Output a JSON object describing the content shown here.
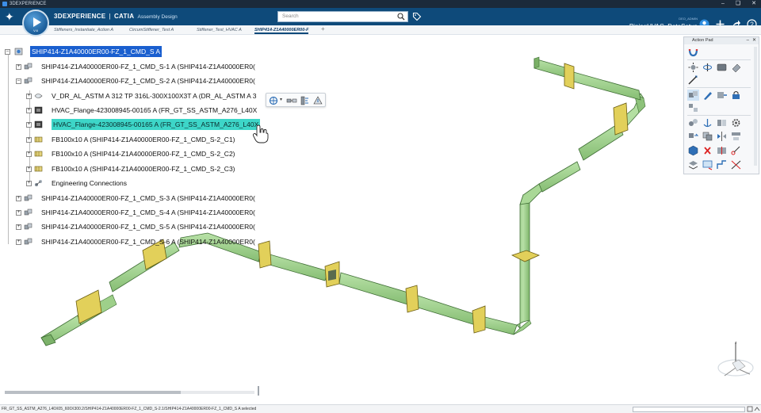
{
  "os": {
    "title": "3DEXPERIENCE"
  },
  "header": {
    "brand": "3DEXPERIENCE",
    "separator": "|",
    "product": "CATIA",
    "app_name": "Assembly Design",
    "search_placeholder": "Search",
    "user_small": "DEO_ADMIN",
    "user_name": "PipingHVAC_DataSetup",
    "compass_label": "V.6"
  },
  "tabs": [
    {
      "label": "Stiffeners_Instantiate_Action A"
    },
    {
      "label": "CircumStiffener_Test A"
    },
    {
      "label": "Stiffener_Test_HVAC A"
    },
    {
      "label": "SHIP414-Z1A40000ER00-F"
    }
  ],
  "tree": {
    "root": "SHIP414-Z1A40000ER00-FZ_1_CMD_S A",
    "nodes": [
      "SHIP414-Z1A40000ER00-FZ_1_CMD_S-1 A (SHIP414-Z1A40000ER0(",
      "SHIP414-Z1A40000ER00-FZ_1_CMD_S-2 A (SHIP414-Z1A40000ER0(",
      "V_DR_AL_ASTM A 312 TP 316L-300X100X3T A (DR_AL_ASTM A 3",
      "HVAC_Flange-423008945-00165 A (FR_GT_SS_ASTM_A276_L40X",
      "HVAC_Flange-423008945-00165 A (FR_GT_SS_ASTM_A276_L40X",
      "FB100x10 A (SHIP414-Z1A40000ER00-FZ_1_CMD_S-2_C1)",
      "FB100x10 A (SHIP414-Z1A40000ER00-FZ_1_CMD_S-2_C2)",
      "FB100x10 A (SHIP414-Z1A40000ER00-FZ_1_CMD_S-2_C3)",
      "Engineering Connections",
      "SHIP414-Z1A40000ER00-FZ_1_CMD_S-3 A (SHIP414-Z1A40000ER0(",
      "SHIP414-Z1A40000ER00-FZ_1_CMD_S-4 A (SHIP414-Z1A40000ER0(",
      "SHIP414-Z1A40000ER00-FZ_1_CMD_S-5 A (SHIP414-Z1A40000ER0(",
      "SHIP414-Z1A40000ER00-FZ_1_CMD_S-6 A (SHIP414-Z1A40000ER0("
    ]
  },
  "action_pad": {
    "title": "Action Pad"
  },
  "compass_axis": "z",
  "status": {
    "message": "FR_GT_SS_ASTM_A276_L40X05_600X300.2/SHIP414-Z1A40000ER00-FZ_1_CMD_S-2.1/SHIP414-Z1A40000ER00-FZ_1_CMD_S A selected"
  },
  "colors": {
    "header": "#0e4a7a",
    "duct": "#9dd28a",
    "duct_edge": "#3f6e35",
    "flange": "#e2d05a",
    "selection_blue": "#1a5fcf",
    "selection_cyan": "#3dd6c8"
  }
}
